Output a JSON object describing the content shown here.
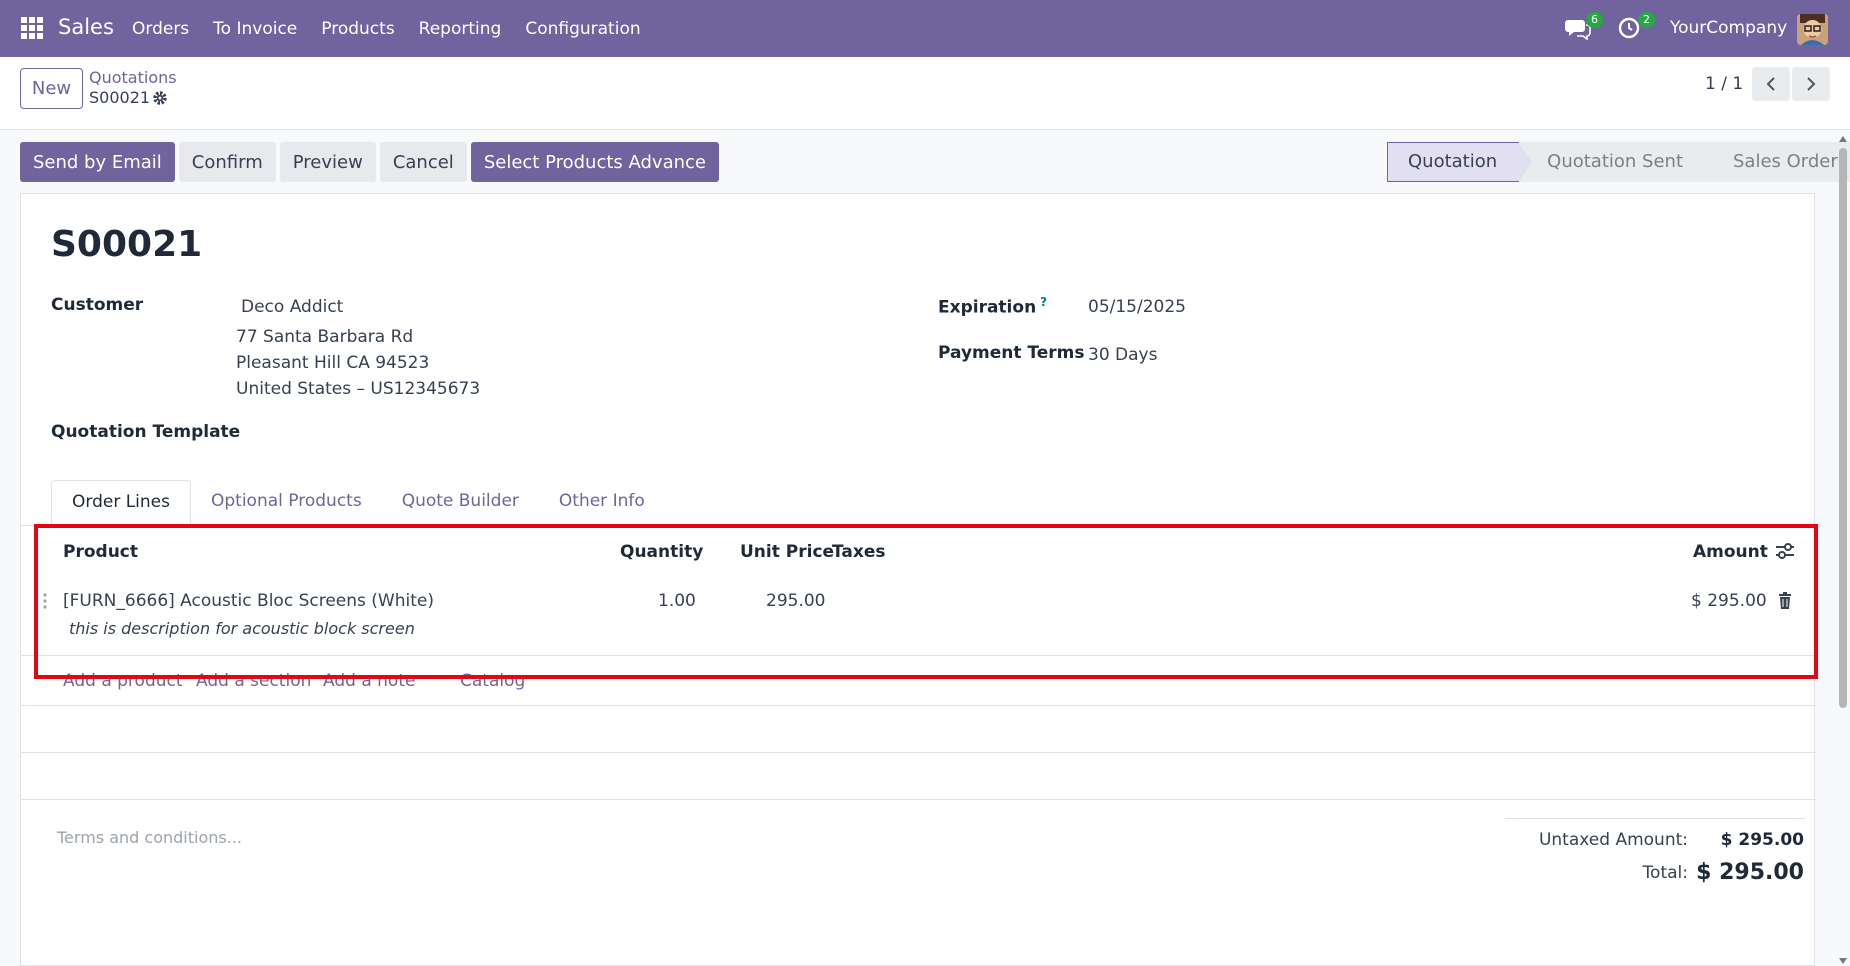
{
  "navbar": {
    "app_name": "Sales",
    "menu": [
      "Orders",
      "To Invoice",
      "Products",
      "Reporting",
      "Configuration"
    ],
    "messages_count": "6",
    "activities_count": "2",
    "company": "YourCompany",
    "color": "#71639e"
  },
  "control": {
    "new_label": "New",
    "breadcrumb": "Quotations",
    "record": "S00021",
    "pager": "1 / 1"
  },
  "actions": {
    "send_email": "Send by Email",
    "confirm": "Confirm",
    "preview": "Preview",
    "cancel": "Cancel",
    "select_products": "Select Products Advance"
  },
  "status": {
    "stages": [
      "Quotation",
      "Quotation Sent",
      "Sales Order"
    ],
    "active": "Quotation"
  },
  "form": {
    "title": "S00021",
    "customer_label": "Customer",
    "customer_name": "Deco Addict",
    "address_line1": "77 Santa Barbara Rd",
    "address_line2": "Pleasant Hill CA 94523",
    "address_line3": "United States – US12345673",
    "template_label": "Quotation Template",
    "expiration_label": "Expiration",
    "expiration_help": "?",
    "expiration_value": "05/15/2025",
    "payment_terms_label": "Payment Terms",
    "payment_terms_value": "30 Days"
  },
  "tabs": [
    "Order Lines",
    "Optional Products",
    "Quote Builder",
    "Other Info"
  ],
  "order_lines": {
    "headers": {
      "product": "Product",
      "quantity": "Quantity",
      "unit_price": "Unit Price",
      "taxes": "Taxes",
      "amount": "Amount"
    },
    "rows": [
      {
        "product": "[FURN_6666] Acoustic Bloc Screens (White)",
        "description": "this is description for acoustic block screen",
        "quantity": "1.00",
        "unit_price": "295.00",
        "taxes": "",
        "amount": "$ 295.00"
      }
    ],
    "add_product": "Add a product",
    "add_section": "Add a section",
    "add_note": "Add a note",
    "catalog": "Catalog"
  },
  "footer": {
    "terms_placeholder": "Terms and conditions...",
    "untaxed_label": "Untaxed Amount:",
    "untaxed_value": "$ 295.00",
    "total_label": "Total:",
    "total_value": "$ 295.00"
  },
  "highlight_color": "#e30613"
}
